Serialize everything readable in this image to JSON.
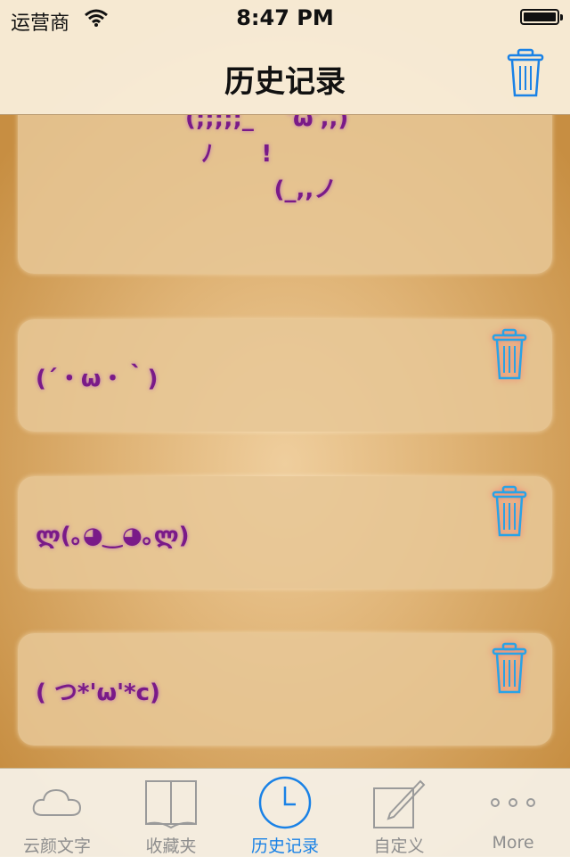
{
  "status_bar": {
    "carrier": "运营商",
    "time": "8:47 PM"
  },
  "nav": {
    "title": "历史记录",
    "trash_icon": "trash-icon"
  },
  "items": [
    {
      "lines": [
        " ╱          ╲",
        "(;;;;;_    'ω',,)",
        "  ﾉ      !",
        "           (_,,ノ"
      ]
    },
    {
      "text": "(´・ω・｀)"
    },
    {
      "text": "ლ(｡◕‿◕｡ლ)"
    },
    {
      "text": "( つ*'ω'*c)"
    }
  ],
  "tabs": [
    {
      "label": "云颜文字",
      "icon": "cloud-icon",
      "active": false
    },
    {
      "label": "收藏夹",
      "icon": "book-icon",
      "active": false
    },
    {
      "label": "历史记录",
      "icon": "clock-icon",
      "active": true
    },
    {
      "label": "自定义",
      "icon": "edit-icon",
      "active": false
    },
    {
      "label": "More",
      "icon": "more-icon",
      "active": false
    }
  ],
  "colors": {
    "accent": "#1a82e6",
    "emote": "#7a1a88",
    "delete_glow": "#ff5a5a"
  }
}
